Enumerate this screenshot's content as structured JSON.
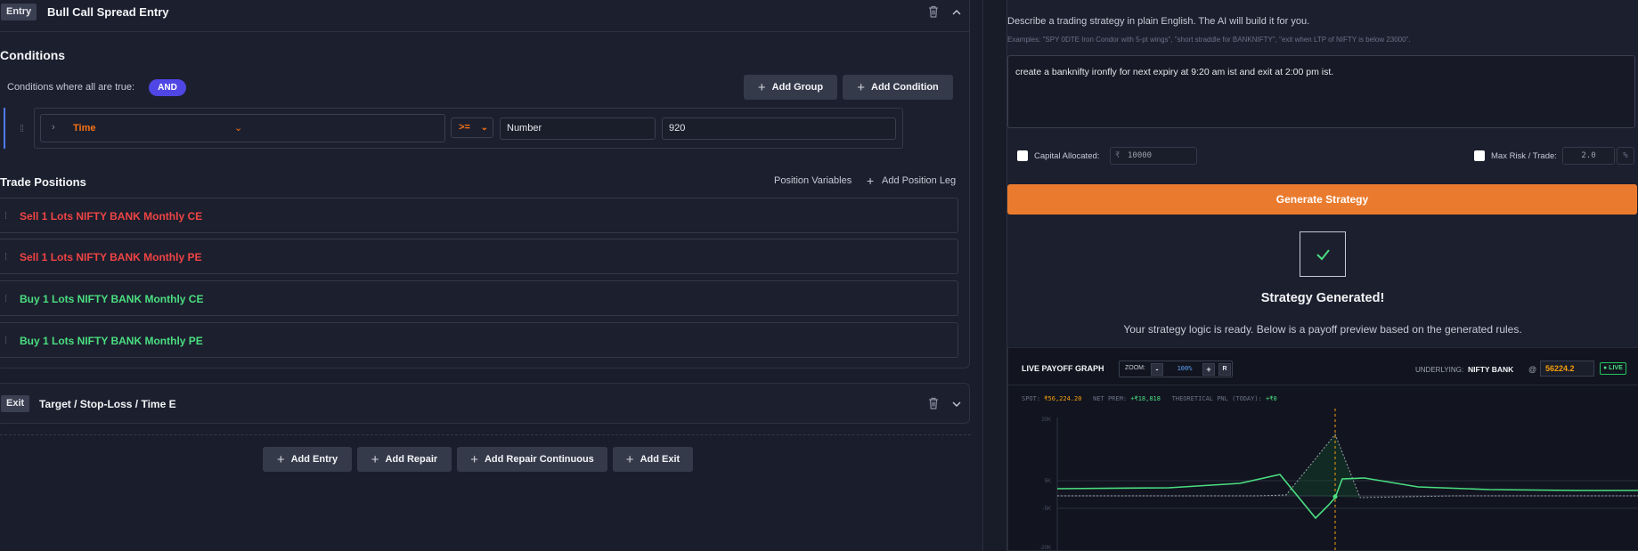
{
  "entry": {
    "tag": "Entry",
    "title": "Bull Call Spread Entry",
    "conditions_title": "Conditions",
    "conditions_label": "Conditions where all are true:",
    "logic": "AND",
    "add_group": "Add Group",
    "add_condition": "Add Condition",
    "condition": {
      "field": "Time",
      "operator": ">=",
      "type": "Number",
      "value": "920"
    },
    "positions_title": "Trade Positions",
    "position_variables": "Position Variables",
    "add_position_leg": "Add Position Leg",
    "positions": [
      {
        "label": "Sell 1 Lots NIFTY BANK Monthly CE",
        "side": "sell"
      },
      {
        "label": "Sell 1 Lots NIFTY BANK Monthly PE",
        "side": "sell"
      },
      {
        "label": "Buy 1 Lots NIFTY BANK Monthly CE",
        "side": "buy"
      },
      {
        "label": "Buy 1 Lots NIFTY BANK Monthly PE",
        "side": "buy"
      }
    ]
  },
  "exit": {
    "tag": "Exit",
    "title": "Target / Stop-Loss / Time E"
  },
  "footer_buttons": {
    "add_entry": "Add Entry",
    "add_repair": "Add Repair",
    "add_repair_continuous": "Add Repair Continuous",
    "add_exit": "Add Exit"
  },
  "ai": {
    "description": "Describe a trading strategy in plain English. The AI will build it for you.",
    "examples": "Examples: \"SPY 0DTE Iron Condor with 5-pt wings\", \"short straddle for BANKNIFTY\", \"exit when LTP of NIFTY is below 23000\".",
    "prompt": "create a banknifty ironfly for next expiry at 9:20 am ist and exit at 2:00 pm ist.",
    "capital_label": "Capital Allocated:",
    "capital_currency": "₹",
    "capital_value": "10000",
    "max_risk_label": "Max Risk / Trade:",
    "max_risk_value": "2.0",
    "max_risk_unit": "%",
    "generate_button": "Generate Strategy",
    "generated_title": "Strategy Generated!",
    "generated_sub": "Your strategy logic is ready. Below is a payoff preview based on the generated rules."
  },
  "payoff": {
    "title": "LIVE PAYOFF GRAPH",
    "zoom_label": "ZOOM:",
    "zoom_minus": "-",
    "zoom_value": "100%",
    "zoom_plus": "+",
    "zoom_reset": "R",
    "underlying_label": "UNDERLYING:",
    "underlying": "NIFTY BANK",
    "at": "@",
    "spot_input": "56224.2",
    "live": "● LIVE",
    "spot_label": "SPOT:",
    "spot_value": "₹56,224.20",
    "net_prem_label": "NET PREM:",
    "net_prem_value": "+₹18,818",
    "pnl_label": "THEORETICAL PNL (TODAY):",
    "pnl_value": "+₹0",
    "y_ticks": [
      "20K",
      "5K",
      "-5K",
      "-20K"
    ],
    "colors": {
      "expiry_line": "#4ade80",
      "today_line": "#9ca3af",
      "spot_line": "#f59e0b"
    }
  }
}
